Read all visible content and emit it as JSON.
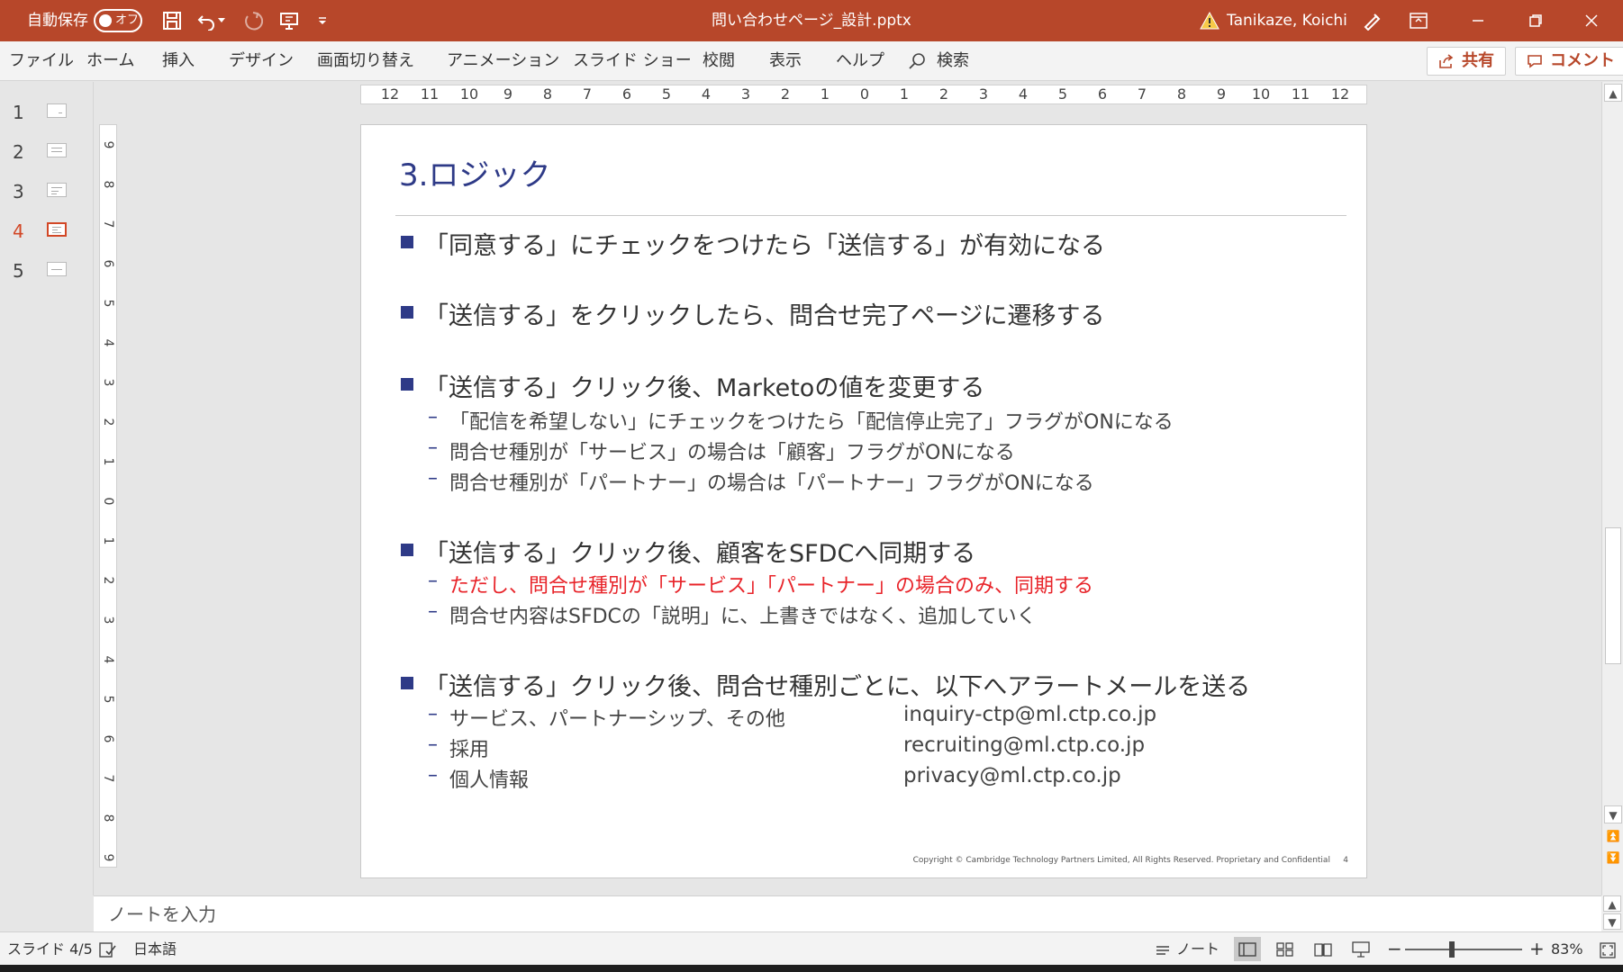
{
  "titlebar": {
    "autosave_label": "自動保存",
    "autosave_state": "オフ",
    "filename": "問い合わせページ_設計.pptx",
    "user": "Tanikaze, Koichi"
  },
  "ribbon": {
    "tabs": [
      "ファイル",
      "ホーム",
      "挿入",
      "デザイン",
      "画面切り替え",
      "アニメーション",
      "スライド ショー",
      "校閲",
      "表示",
      "ヘルプ"
    ],
    "search_label": "検索",
    "share_label": "共有",
    "comment_label": "コメント"
  },
  "thumbnails": {
    "numbers": [
      "1",
      "2",
      "3",
      "4",
      "5"
    ],
    "active_index": 3
  },
  "ruler": {
    "horizontal": [
      "12",
      "11",
      "10",
      "9",
      "8",
      "7",
      "6",
      "5",
      "4",
      "3",
      "2",
      "1",
      "0",
      "1",
      "2",
      "3",
      "4",
      "5",
      "6",
      "7",
      "8",
      "9",
      "10",
      "11",
      "12"
    ],
    "vertical": [
      "9",
      "8",
      "7",
      "6",
      "5",
      "4",
      "3",
      "2",
      "1",
      "0",
      "1",
      "2",
      "3",
      "4",
      "5",
      "6",
      "7",
      "8",
      "9"
    ]
  },
  "slide": {
    "title": "3.ロジック",
    "bullets": [
      {
        "text": "「同意する」にチェックをつけたら「送信する」が有効になる",
        "subs": []
      },
      {
        "text": "「送信する」をクリックしたら、問合せ完了ページに遷移する",
        "subs": []
      },
      {
        "text": "「送信する」クリック後、Marketoの値を変更する",
        "subs": [
          {
            "text": "「配信を希望しない」にチェックをつけたら「配信停止完了」フラグがONになる"
          },
          {
            "text": "問合せ種別が「サービス」の場合は「顧客」フラグがONになる"
          },
          {
            "text": "問合せ種別が「パートナー」の場合は「パートナー」フラグがONになる"
          }
        ]
      },
      {
        "text": "「送信する」クリック後、顧客をSFDCへ同期する",
        "subs": [
          {
            "text": "ただし、問合せ種別が「サービス」「パートナー」の場合のみ、同期する",
            "highlight": true
          },
          {
            "text": "問合せ内容はSFDCの「説明」に、上書きではなく、追加していく"
          }
        ]
      },
      {
        "text": "「送信する」クリック後、問合せ種別ごとに、以下へアラートメールを送る",
        "subs": [
          {
            "text": "サービス、パートナーシップ、その他",
            "email": "inquiry-ctp@ml.ctp.co.jp"
          },
          {
            "text": "採用",
            "email": "recruiting@ml.ctp.co.jp"
          },
          {
            "text": "個人情報",
            "email": "privacy@ml.ctp.co.jp"
          }
        ]
      }
    ],
    "copyright": "Copyright © Cambridge Technology Partners Limited,   All Rights Reserved. Proprietary and Confidential",
    "page_number": "4"
  },
  "notes": {
    "placeholder": "ノートを入力"
  },
  "status": {
    "slide_indicator": "スライド 4/5",
    "language": "日本語",
    "notes_label": "ノート",
    "zoom": "83%"
  },
  "colors": {
    "accent": "#b7472a",
    "title_blue": "#2e3a87",
    "highlight_red": "#e8242a"
  }
}
